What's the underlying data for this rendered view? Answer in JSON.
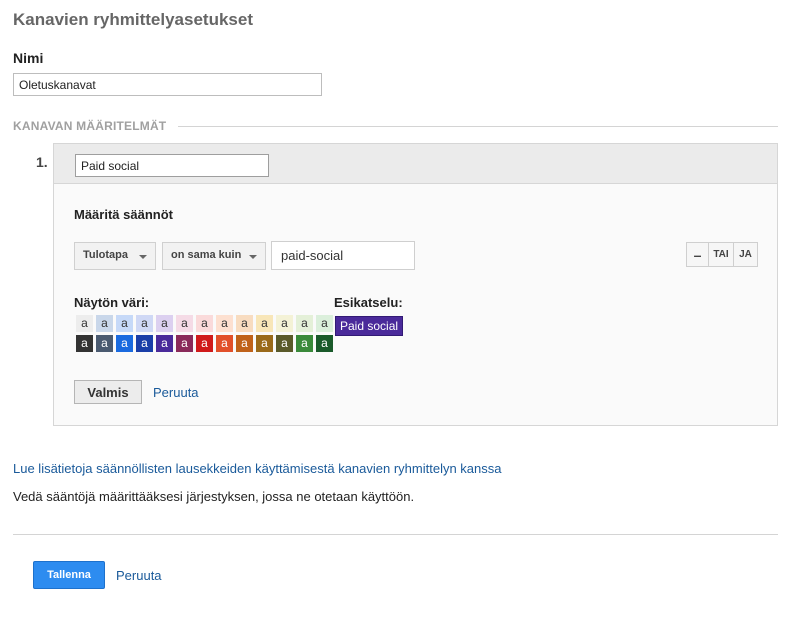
{
  "page": {
    "title": "Kanavien ryhmittelyasetukset",
    "name_label": "Nimi",
    "name_value": "Oletuskanavat",
    "section_label": "KANAVAN MÄÄRITELMÄT"
  },
  "channel": {
    "number": "1.",
    "name_value": "Paid social",
    "rules_title": "Määritä säännöt",
    "rule": {
      "dimension": "Tulotapa",
      "operator": "on sama kuin",
      "value": "paid-social"
    },
    "buttons": {
      "minus": "–",
      "or": "TAI",
      "and": "JA"
    },
    "color_label": "Näytön väri:",
    "preview_label": "Esikatselu:",
    "preview_text": "Paid social",
    "preview_color": "#4a2a9a",
    "done_label": "Valmis",
    "cancel_label": "Peruuta"
  },
  "palette": {
    "swatch_char": "a",
    "light": [
      {
        "bg": "#ededed",
        "fg": "#333333"
      },
      {
        "bg": "#c9d7ea",
        "fg": "#333333"
      },
      {
        "bg": "#c6d9f8",
        "fg": "#333333"
      },
      {
        "bg": "#cfd8f5",
        "fg": "#333333"
      },
      {
        "bg": "#dcd0f0",
        "fg": "#333333"
      },
      {
        "bg": "#f5dbe6",
        "fg": "#333333"
      },
      {
        "bg": "#fadada",
        "fg": "#333333"
      },
      {
        "bg": "#fde0d0",
        "fg": "#333333"
      },
      {
        "bg": "#f8dcc0",
        "fg": "#333333"
      },
      {
        "bg": "#f8e6b8",
        "fg": "#333333"
      },
      {
        "bg": "#f4f2d6",
        "fg": "#333333"
      },
      {
        "bg": "#e4f0d8",
        "fg": "#333333"
      },
      {
        "bg": "#dbefdb",
        "fg": "#333333"
      }
    ],
    "dark": [
      {
        "bg": "#333333",
        "fg": "#ffffff"
      },
      {
        "bg": "#4a5a70",
        "fg": "#ffffff"
      },
      {
        "bg": "#1a6adf",
        "fg": "#ffffff"
      },
      {
        "bg": "#1a3ea8",
        "fg": "#ffffff"
      },
      {
        "bg": "#4a2a9a",
        "fg": "#ffffff"
      },
      {
        "bg": "#8a2a5a",
        "fg": "#ffffff"
      },
      {
        "bg": "#d01a1a",
        "fg": "#ffffff"
      },
      {
        "bg": "#e2502a",
        "fg": "#ffffff"
      },
      {
        "bg": "#c0621a",
        "fg": "#ffffff"
      },
      {
        "bg": "#9a6a1a",
        "fg": "#ffffff"
      },
      {
        "bg": "#5a5a2a",
        "fg": "#ffffff"
      },
      {
        "bg": "#3a8a3a",
        "fg": "#ffffff"
      },
      {
        "bg": "#1a5a2a",
        "fg": "#ffffff"
      }
    ]
  },
  "footer": {
    "help_link": "Lue lisätietoja säännöllisten lausekkeiden käyttämisestä kanavien ryhmittelyn kanssa",
    "help_text": "Vedä sääntöjä määrittääksesi järjestyksen, jossa ne otetaan käyttöön.",
    "save_label": "Tallenna",
    "cancel_label": "Peruuta"
  }
}
